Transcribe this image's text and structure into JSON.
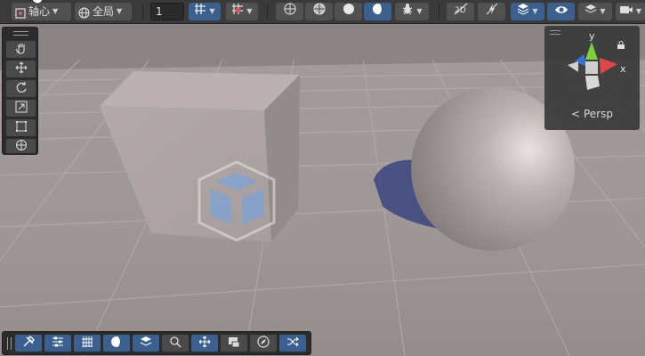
{
  "toolbar": {
    "pivot_label": "轴心",
    "global_label": "全局",
    "grid_snap_value": "1"
  },
  "gizmo": {
    "axis_y": "y",
    "axis_x": "x",
    "projection_label": "Persp"
  },
  "icons": {
    "pivot": "pivot-icon",
    "global": "globe-icon",
    "grid-snap": "grid-snap-icon",
    "increment-snap": "increment-snap-icon",
    "shading": [
      "wireframe-icon",
      "shaded-wire-icon",
      "shaded-icon",
      "lit-icon"
    ],
    "debug": "bug-icon",
    "2d": "2d-toggle-icon",
    "lighting": "lighting-icon",
    "layers": "layers-icon",
    "visibility": "eye-icon",
    "camera": "camera-icon"
  },
  "colors": {
    "toolbar_bg": "#3a3a3a",
    "button_bg": "#515151",
    "active_blue": "#3b5f8f",
    "axis_y_green": "#7bd13a",
    "axis_x_red": "#e04848",
    "axis_z_blue": "#3a6fd8"
  }
}
